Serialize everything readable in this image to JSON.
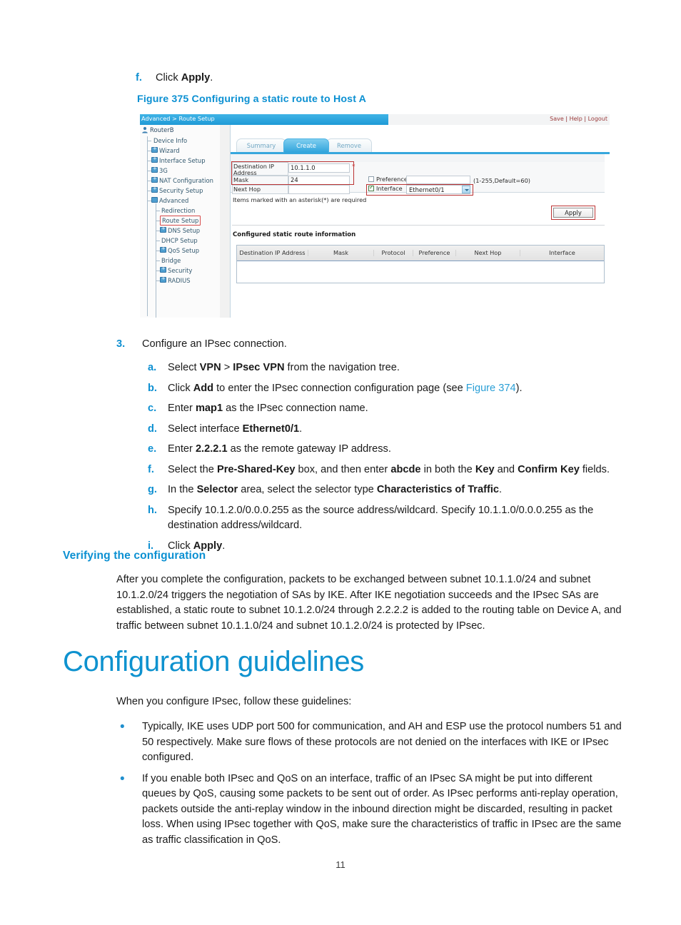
{
  "page": {
    "number": "11"
  },
  "step_f_top": {
    "marker": "f.",
    "text_before": "Click ",
    "bold": "Apply",
    "text_after": "."
  },
  "figure": {
    "caption": "Figure 375 Configuring a static route to Host A",
    "breadcrumb": "Advanced > Route Setup",
    "header_links": [
      "Save",
      "Help",
      "Logout"
    ],
    "nav": {
      "root": "RouterB",
      "items": [
        {
          "label": "Device Info",
          "icon": "none",
          "level": 1
        },
        {
          "label": "Wizard",
          "icon": "folder-plus-icon",
          "level": 1
        },
        {
          "label": "Interface Setup",
          "icon": "folder-plus-icon",
          "level": 1
        },
        {
          "label": "3G",
          "icon": "folder-plus-icon",
          "level": 1
        },
        {
          "label": "NAT Configuration",
          "icon": "folder-plus-icon",
          "level": 1
        },
        {
          "label": "Security Setup",
          "icon": "folder-plus-icon",
          "level": 1
        },
        {
          "label": "Advanced",
          "icon": "folder-open-icon",
          "level": 1
        },
        {
          "label": "Redirection",
          "icon": "none",
          "level": 2
        },
        {
          "label": "Route Setup",
          "icon": "none",
          "level": 2,
          "selected": true
        },
        {
          "label": "DNS Setup",
          "icon": "folder-plus-icon",
          "level": 2
        },
        {
          "label": "DHCP Setup",
          "icon": "none",
          "level": 2
        },
        {
          "label": "QoS Setup",
          "icon": "folder-plus-icon",
          "level": 2
        },
        {
          "label": "Bridge",
          "icon": "none",
          "level": 2
        },
        {
          "label": "Security",
          "icon": "folder-plus-icon",
          "level": 2
        },
        {
          "label": "RADIUS",
          "icon": "folder-plus-icon",
          "level": 2
        }
      ]
    },
    "tabs": [
      {
        "label": "Summary",
        "active": false
      },
      {
        "label": "Create",
        "active": true
      },
      {
        "label": "Remove",
        "active": false
      }
    ],
    "form": {
      "dest_ip_label": "Destination IP Address",
      "dest_ip_value": "10.1.1.0",
      "dest_ip_required": "*",
      "mask_label": "Mask",
      "mask_value": "24",
      "next_hop_label": "Next Hop",
      "next_hop_value": "",
      "preference_label": "Preference",
      "preference_checked": false,
      "preference_value": "",
      "preference_hint": "(1-255,Default=60)",
      "interface_label": "Interface",
      "interface_checked": true,
      "interface_value": "Ethernet0/1"
    },
    "required_note": "Items marked with an asterisk(*) are required",
    "apply_label": "Apply",
    "table_title": "Configured static route information",
    "table_headers": [
      "Destination IP Address",
      "Mask",
      "Protocol",
      "Preference",
      "Next Hop",
      "Interface"
    ],
    "table_rows": []
  },
  "step3": {
    "marker": "3.",
    "text": "Configure an IPsec connection."
  },
  "substeps": [
    {
      "marker": "a.",
      "parts": [
        {
          "t": "Select ",
          "b": false
        },
        {
          "t": "VPN",
          "b": true
        },
        {
          "t": " > ",
          "b": false
        },
        {
          "t": "IPsec VPN",
          "b": true
        },
        {
          "t": " from the navigation tree.",
          "b": false
        }
      ]
    },
    {
      "marker": "b.",
      "parts": [
        {
          "t": "Click ",
          "b": false
        },
        {
          "t": "Add",
          "b": true
        },
        {
          "t": " to enter the IPsec connection configuration page (see ",
          "b": false
        },
        {
          "t": "Figure 374",
          "b": false,
          "link": true
        },
        {
          "t": ").",
          "b": false
        }
      ]
    },
    {
      "marker": "c.",
      "parts": [
        {
          "t": "Enter ",
          "b": false
        },
        {
          "t": "map1",
          "b": true
        },
        {
          "t": " as the IPsec connection name.",
          "b": false
        }
      ]
    },
    {
      "marker": "d.",
      "parts": [
        {
          "t": "Select interface ",
          "b": false
        },
        {
          "t": "Ethernet0/1",
          "b": true
        },
        {
          "t": ".",
          "b": false
        }
      ]
    },
    {
      "marker": "e.",
      "parts": [
        {
          "t": "Enter ",
          "b": false
        },
        {
          "t": "2.2.2.1",
          "b": true
        },
        {
          "t": " as the remote gateway IP address.",
          "b": false
        }
      ]
    },
    {
      "marker": "f.",
      "parts": [
        {
          "t": "Select the ",
          "b": false
        },
        {
          "t": "Pre-Shared-Key",
          "b": true
        },
        {
          "t": " box, and then enter ",
          "b": false
        },
        {
          "t": "abcde",
          "b": true
        },
        {
          "t": " in both the ",
          "b": false
        },
        {
          "t": "Key",
          "b": true
        },
        {
          "t": " and ",
          "b": false
        },
        {
          "t": "Confirm Key",
          "b": true
        },
        {
          "t": " fields.",
          "b": false
        }
      ]
    },
    {
      "marker": "g.",
      "parts": [
        {
          "t": "In the ",
          "b": false
        },
        {
          "t": "Selector",
          "b": true
        },
        {
          "t": " area, select the selector type ",
          "b": false
        },
        {
          "t": "Characteristics of Traffic",
          "b": true
        },
        {
          "t": ".",
          "b": false
        }
      ]
    },
    {
      "marker": "h.",
      "parts": [
        {
          "t": "Specify 10.1.2.0/0.0.0.255 as the source address/wildcard. Specify 10.1.1.0/0.0.0.255 as the destination address/wildcard.",
          "b": false
        }
      ]
    },
    {
      "marker": "i.",
      "parts": [
        {
          "t": "Click ",
          "b": false
        },
        {
          "t": "Apply",
          "b": true
        },
        {
          "t": ".",
          "b": false
        }
      ]
    }
  ],
  "verifying": {
    "heading": "Verifying the configuration",
    "paragraph": "After you complete the configuration, packets to be exchanged between subnet 10.1.1.0/24 and subnet 10.1.2.0/24 triggers the negotiation of SAs by IKE. After IKE negotiation succeeds and the IPsec SAs are established, a static route to subnet 10.1.2.0/24 through 2.2.2.2 is added to the routing table on Device A, and traffic between subnet 10.1.1.0/24 and subnet 10.1.2.0/24 is protected by IPsec."
  },
  "guidelines": {
    "heading": "Configuration guidelines",
    "intro": "When you configure IPsec, follow these guidelines:",
    "bullets": [
      "Typically, IKE uses UDP port 500 for communication, and AH and ESP use the protocol numbers 51 and 50 respectively. Make sure flows of these protocols are not denied on the interfaces with IKE or IPsec configured.",
      "If you enable both IPsec and QoS on an interface, traffic of an IPsec SA might be put into different queues by QoS, causing some packets to be sent out of order. As IPsec performs anti-replay operation, packets outside the anti-replay window in the inbound direction might be discarded, resulting in packet loss. When using IPsec together with QoS, make sure the characteristics of traffic in IPsec are the same as traffic classification in QoS."
    ]
  },
  "colors": {
    "heading_blue": "#0e92cf",
    "caption_blue": "#0b90d2",
    "marker_blue": "#0d8fd1",
    "ui_accent": "#2ea6dd",
    "highlight_red": "#b33333"
  }
}
